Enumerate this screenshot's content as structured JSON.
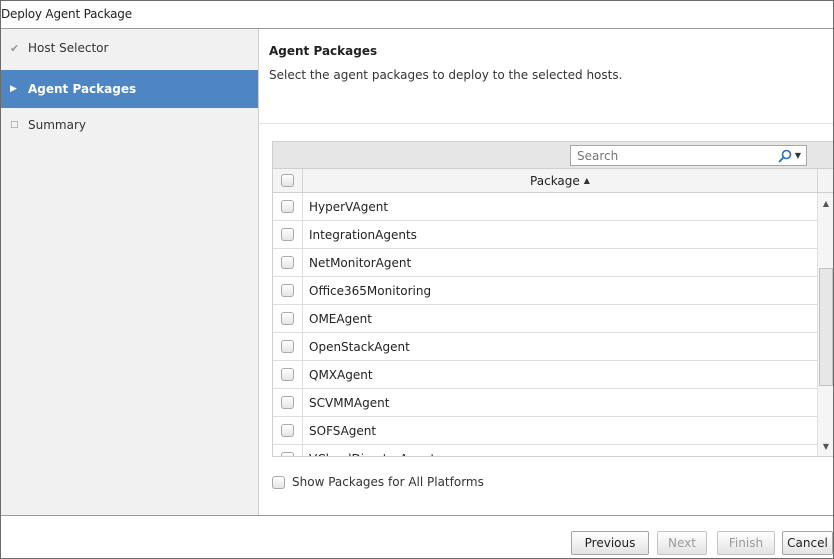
{
  "window": {
    "title": "Deploy Agent Package"
  },
  "steps": [
    {
      "label": "Host Selector",
      "state": "completed"
    },
    {
      "label": "Agent Packages",
      "state": "active"
    },
    {
      "label": "Summary",
      "state": "pending"
    }
  ],
  "content": {
    "title": "Agent Packages",
    "description": "Select the agent packages to deploy to the selected hosts."
  },
  "search": {
    "placeholder": "Search"
  },
  "grid": {
    "column_package": "Package",
    "sort": "ascending",
    "rows": [
      "HyperVAgent",
      "IntegrationAgents",
      "NetMonitorAgent",
      "Office365Monitoring",
      "OMEAgent",
      "OpenStackAgent",
      "QMXAgent",
      "SCVMMAgent",
      "SOFSAgent",
      "VCloudDirectorAgent"
    ]
  },
  "options": {
    "all_platforms_label": "Show Packages for All Platforms"
  },
  "buttons": {
    "previous": "Previous",
    "next": "Next",
    "finish": "Finish",
    "cancel": "Cancel"
  },
  "icons": {
    "completed_step": "check-icon",
    "active_step": "play-triangle-icon",
    "pending_step": "hollow-square-icon",
    "search": "magnifier-icon",
    "sort": "triangle-up-icon"
  },
  "colors": {
    "active_step_bg": "#4d86c3",
    "nav_bg": "#f1f1f1",
    "search_icon": "#2d6cb4"
  }
}
